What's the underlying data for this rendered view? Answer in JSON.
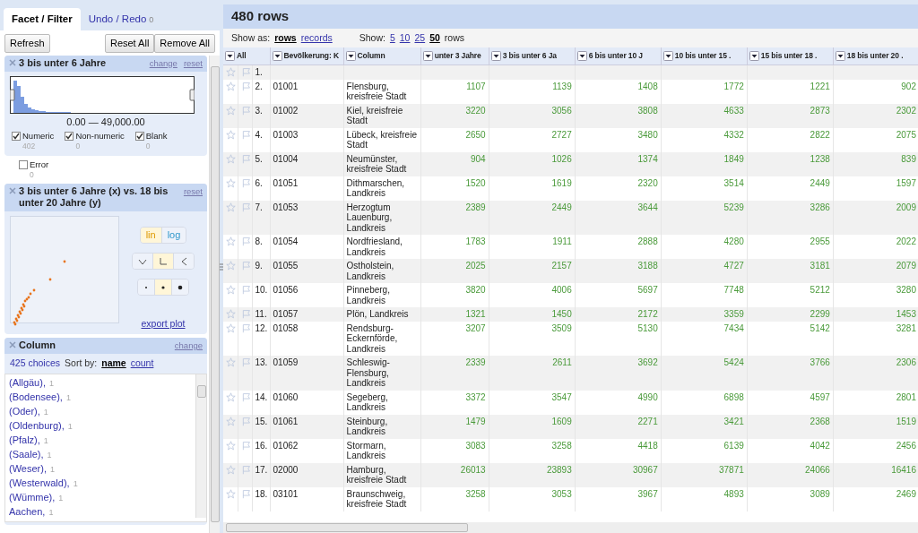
{
  "left_tabs": [
    {
      "label": "Facet / Filter",
      "selected": true
    },
    {
      "label": "Undo / Redo",
      "count": "0",
      "selected": false
    }
  ],
  "toolbar": {
    "refresh": "Refresh",
    "buttons": [
      "Reset All",
      "Remove All"
    ]
  },
  "facets": [
    {
      "kind": "range",
      "title": "3 bis unter 6 Jahre",
      "links": [
        "change",
        "reset"
      ],
      "range": "0.00 — 49,000.00",
      "options": [
        {
          "label": "Numeric",
          "count": "402",
          "checked": true
        },
        {
          "label": "Non-numeric",
          "count": "0",
          "checked": true
        },
        {
          "label": "Blank",
          "count": "0",
          "checked": true
        },
        {
          "label": "Error",
          "count": "0",
          "checked": false
        }
      ]
    },
    {
      "kind": "scatter",
      "title": "3 bis unter 6 Jahre (x) vs. 18 bis unter 20 Jahre (y)",
      "links": [
        "reset"
      ],
      "scales": [
        {
          "label": "lin",
          "selected": true
        },
        {
          "label": "log",
          "selected": false
        }
      ],
      "rotations": [
        {
          "kind": "down",
          "selected": false
        },
        {
          "kind": "none",
          "selected": true
        },
        {
          "kind": "left",
          "selected": false
        }
      ],
      "dot_sizes": [
        {
          "kind": "small",
          "selected": false
        },
        {
          "kind": "medium",
          "selected": true
        },
        {
          "kind": "large",
          "selected": false
        }
      ],
      "export": "export plot"
    },
    {
      "kind": "list",
      "title": "Column",
      "links": [
        "change"
      ],
      "summary": "425 choices",
      "sort_label": "Sort by:",
      "sort_options": [
        {
          "label": "name",
          "selected": true
        },
        {
          "label": "count",
          "selected": false
        }
      ],
      "choices": [
        {
          "label": "(Allgäu),",
          "count": "1"
        },
        {
          "label": "(Bodensee),",
          "count": "1"
        },
        {
          "label": "(Oder),",
          "count": "1"
        },
        {
          "label": "(Oldenburg),",
          "count": "1"
        },
        {
          "label": "(Pfalz),",
          "count": "1"
        },
        {
          "label": "(Saale),",
          "count": "1"
        },
        {
          "label": "(Weser),",
          "count": "1"
        },
        {
          "label": "(Westerwald),",
          "count": "1"
        },
        {
          "label": "(Wümme),",
          "count": "1"
        },
        {
          "label": "Aachen,",
          "count": "1"
        }
      ]
    }
  ],
  "main": {
    "title": "480 rows",
    "show_as_label": "Show as:",
    "modes": [
      {
        "label": "rows",
        "selected": true
      },
      {
        "label": "records",
        "selected": false
      }
    ],
    "show_label": "Show:",
    "page_sizes": [
      {
        "label": "5",
        "selected": false
      },
      {
        "label": "10",
        "selected": false
      },
      {
        "label": "25",
        "selected": false
      },
      {
        "label": "50",
        "selected": true
      }
    ],
    "rows_label": "rows"
  },
  "table": {
    "columns": [
      "All",
      "Bevölkerung: K",
      "Column",
      "unter 3 Jahre",
      "3 bis unter 6 Ja",
      "6 bis unter 10 J",
      "10 bis unter 15 .",
      "15 bis unter 18 .",
      "18 bis unter 20 ."
    ],
    "rows": [
      {
        "number": "1."
      },
      {
        "number": "2.",
        "code": "01001",
        "name": "Flensburg, kreisfreie Stadt",
        "values": [
          "1107",
          "1139",
          "1408",
          "1772",
          "1221",
          "902"
        ]
      },
      {
        "number": "3.",
        "code": "01002",
        "name": "Kiel, kreisfreie Stadt",
        "values": [
          "3220",
          "3056",
          "3808",
          "4633",
          "2873",
          "2302"
        ]
      },
      {
        "number": "4.",
        "code": "01003",
        "name": "Lübeck, kreisfreie Stadt",
        "values": [
          "2650",
          "2727",
          "3480",
          "4332",
          "2822",
          "2075"
        ]
      },
      {
        "number": "5.",
        "code": "01004",
        "name": "Neumünster, kreisfreie Stadt",
        "values": [
          "904",
          "1026",
          "1374",
          "1849",
          "1238",
          "839"
        ]
      },
      {
        "number": "6.",
        "code": "01051",
        "name": "Dithmarschen, Landkreis",
        "values": [
          "1520",
          "1619",
          "2320",
          "3514",
          "2449",
          "1597"
        ]
      },
      {
        "number": "7.",
        "code": "01053",
        "name": "Herzogtum Lauenburg, Landkreis",
        "values": [
          "2389",
          "2449",
          "3644",
          "5239",
          "3286",
          "2009"
        ]
      },
      {
        "number": "8.",
        "code": "01054",
        "name": "Nordfriesland, Landkreis",
        "values": [
          "1783",
          "1911",
          "2888",
          "4280",
          "2955",
          "2022"
        ]
      },
      {
        "number": "9.",
        "code": "01055",
        "name": "Ostholstein, Landkreis",
        "values": [
          "2025",
          "2157",
          "3188",
          "4727",
          "3181",
          "2079"
        ]
      },
      {
        "number": "10.",
        "code": "01056",
        "name": "Pinneberg, Landkreis",
        "values": [
          "3820",
          "4006",
          "5697",
          "7748",
          "5212",
          "3280"
        ]
      },
      {
        "number": "11.",
        "code": "01057",
        "name": "Plön, Landkreis",
        "values": [
          "1321",
          "1450",
          "2172",
          "3359",
          "2299",
          "1453"
        ]
      },
      {
        "number": "12.",
        "code": "01058",
        "name": "Rendsburg-Eckernförde, Landkreis",
        "values": [
          "3207",
          "3509",
          "5130",
          "7434",
          "5142",
          "3281"
        ]
      },
      {
        "number": "13.",
        "code": "01059",
        "name": "Schleswig-Flensburg, Landkreis",
        "values": [
          "2339",
          "2611",
          "3692",
          "5424",
          "3766",
          "2306"
        ]
      },
      {
        "number": "14.",
        "code": "01060",
        "name": "Segeberg, Landkreis",
        "values": [
          "3372",
          "3547",
          "4990",
          "6898",
          "4597",
          "2801"
        ]
      },
      {
        "number": "15.",
        "code": "01061",
        "name": "Steinburg, Landkreis",
        "values": [
          "1479",
          "1609",
          "2271",
          "3421",
          "2368",
          "1519"
        ]
      },
      {
        "number": "16.",
        "code": "01062",
        "name": "Stormarn, Landkreis",
        "values": [
          "3083",
          "3258",
          "4418",
          "6139",
          "4042",
          "2456"
        ]
      },
      {
        "number": "17.",
        "code": "02000",
        "name": "Hamburg, kreisfreie Stadt",
        "values": [
          "26013",
          "23893",
          "30967",
          "37871",
          "24066",
          "16416"
        ]
      },
      {
        "number": "18.",
        "code": "03101",
        "name": "Braunschweig, kreisfreie Stadt",
        "values": [
          "3258",
          "3053",
          "3967",
          "4893",
          "3089",
          "2469"
        ]
      }
    ]
  }
}
